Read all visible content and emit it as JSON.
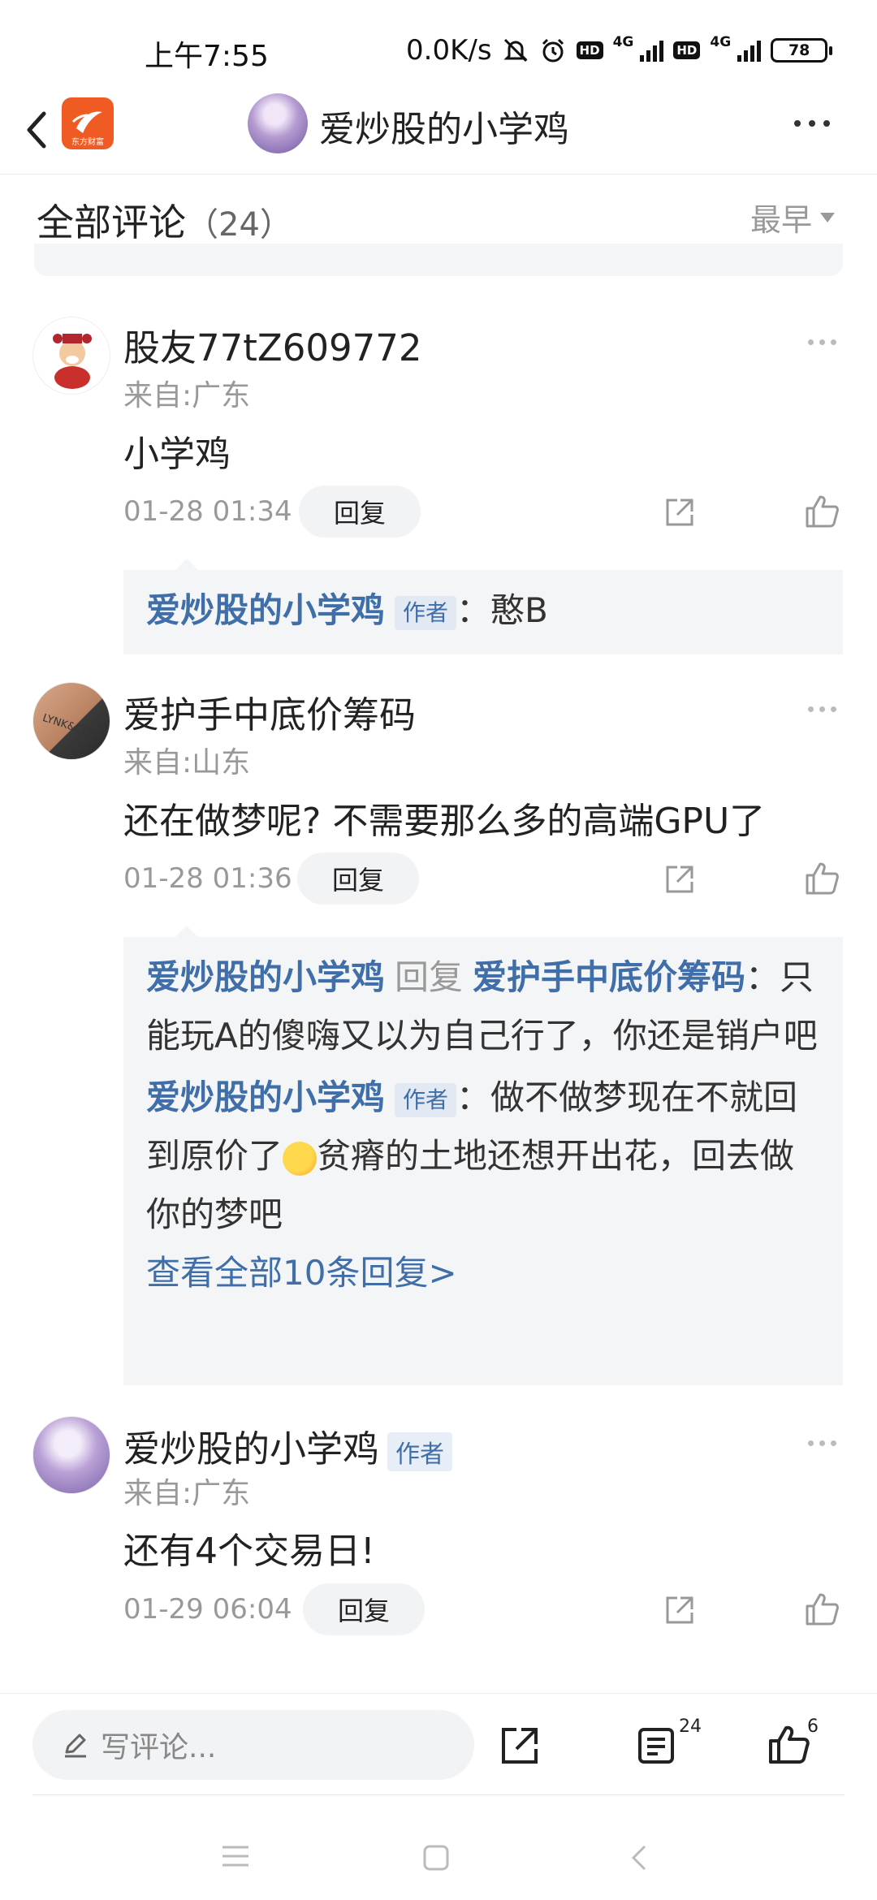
{
  "status": {
    "time": "上午7:55",
    "speed": "0.0K/s",
    "hd": "HD",
    "net": "4G",
    "battery": "78"
  },
  "header": {
    "title": "爱炒股的小学鸡",
    "app_logo_text": "东方财富"
  },
  "section": {
    "title": "全部评论",
    "count": "（24）",
    "sort": "最早"
  },
  "labels": {
    "reply": "回复",
    "author": "作者"
  },
  "comments": [
    {
      "name": "股友77tZ609772",
      "from": "来自:广东",
      "text": "小学鸡",
      "time": "01-28 01:34",
      "replies": [
        {
          "name": "爱炒股的小学鸡",
          "tag": "作者",
          "text": "：憨B"
        }
      ]
    },
    {
      "name": "爱护手中底价筹码",
      "from": "来自:山东",
      "text": "还在做梦呢? 不需要那么多的高端GPU了",
      "time": "01-28 01:36",
      "replies": [
        {
          "name": "爱炒股的小学鸡",
          "reply_word": "回复",
          "target": "爱护手中底价筹码",
          "text": "：只能玩A的傻嗨又以为自己行了，你还是销户吧"
        },
        {
          "name": "爱炒股的小学鸡",
          "tag": "作者",
          "text_before_emoji": "：做不做梦现在不就回到原价了",
          "text_after_emoji": "贫瘠的土地还想开出花，回去做你的梦吧"
        }
      ],
      "view_all": "查看全部10条回复>"
    },
    {
      "name": "爱炒股的小学鸡",
      "tag": "作者",
      "from": "来自:广东",
      "text": "还有4个交易日!",
      "time": "01-29 06:04"
    }
  ],
  "bottom": {
    "placeholder": "写评论...",
    "comments_count": "24",
    "likes_count": "6"
  },
  "colors": {
    "accent_blue": "#3f6ea8",
    "gray_text": "#999999",
    "reply_bg": "#f4f5f7",
    "app_logo": "#f05a23"
  }
}
